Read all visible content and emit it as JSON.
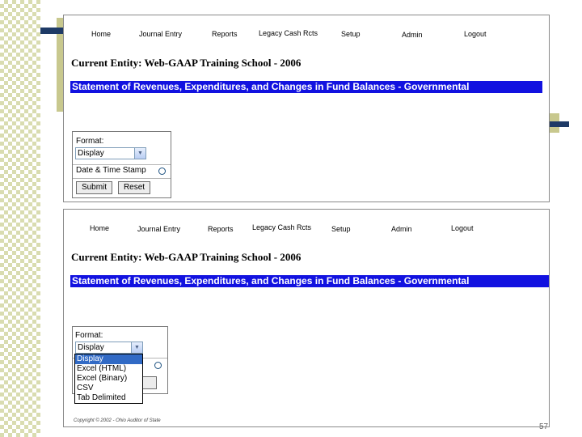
{
  "nav": {
    "home": "Home",
    "journal_entry": "Journal Entry",
    "reports": "Reports",
    "legacy_cash_rcts": "Legacy Cash Rcts",
    "setup": "Setup",
    "admin": "Admin",
    "logout": "Logout"
  },
  "entity": "Current Entity: Web-GAAP Training School - 2006",
  "report_title": "Statement of Revenues, Expenditures, and Changes in Fund Balances - Governmental",
  "form": {
    "format_label": "Format:",
    "format_value": "Display",
    "date_time_label": "Date & Time Stamp",
    "submit_label": "Submit",
    "reset_label": "Reset"
  },
  "dropdown": {
    "options": [
      "Display",
      "Excel (HTML)",
      "Excel (Binary)",
      "CSV",
      "Tab Delimited"
    ],
    "selected": "Display"
  },
  "footer": {
    "copyright": "Copyright © 2002 - Ohio Auditor of State",
    "page_number": "57"
  },
  "colors": {
    "title_bar": "#1212e0",
    "accent_navy": "#1e3a66",
    "olive": "#c8c88e",
    "selected_option": "#316ac5"
  }
}
